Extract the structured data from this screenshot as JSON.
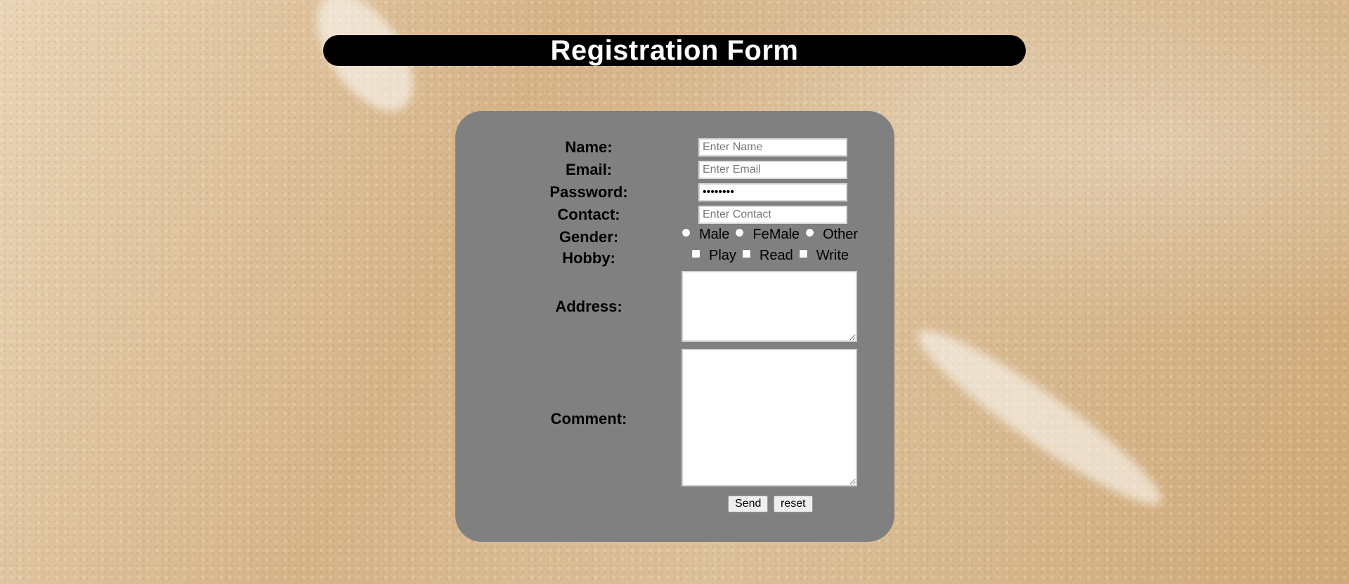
{
  "page": {
    "title": "Registration Form"
  },
  "form": {
    "name_label": "Name:",
    "name_placeholder": "Enter Name",
    "email_label": "Email:",
    "email_placeholder": "Enter Email",
    "password_label": "Password:",
    "password_value": "••••••••",
    "contact_label": "Contact:",
    "contact_placeholder": "Enter Contact",
    "gender_label": "Gender:",
    "gender_options": [
      "Male",
      "FeMale",
      "Other"
    ],
    "hobby_label": "Hobby:",
    "hobby_options": [
      "Play",
      "Read",
      "Write"
    ],
    "address_label": "Address:",
    "comment_label": "Comment:",
    "send_label": "Send",
    "reset_label": "reset"
  },
  "colors": {
    "title_bar_bg": "#000000",
    "form_bg": "#808080"
  }
}
